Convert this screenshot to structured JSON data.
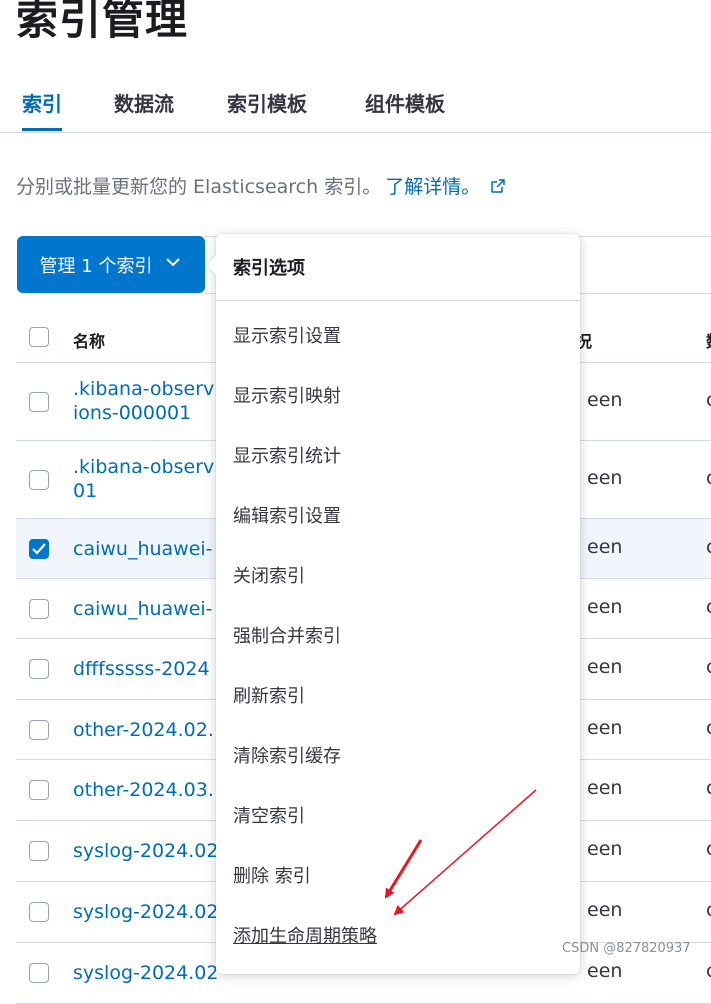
{
  "page": {
    "title": "索引管理"
  },
  "tabs": [
    "索引",
    "数据流",
    "索引模板",
    "组件模板"
  ],
  "description": {
    "text": "分别或批量更新您的 Elasticsearch 索引。",
    "link": "了解详情。"
  },
  "manage_button": {
    "label": "管理 1 个索引"
  },
  "table": {
    "headers": {
      "name": "名称",
      "health": "况",
      "more": "数"
    },
    "rows": [
      {
        "name": ".kibana-observ\nions-000001",
        "health": "een",
        "more": "c",
        "checked": false
      },
      {
        "name": ".kibana-observ\n01",
        "health": "een",
        "more": "c",
        "checked": false
      },
      {
        "name": "caiwu_huawei-",
        "health": "een",
        "more": "c",
        "checked": true
      },
      {
        "name": "caiwu_huawei-",
        "health": "een",
        "more": "c",
        "checked": false
      },
      {
        "name": "dfffsssss-2024",
        "health": "een",
        "more": "c",
        "checked": false
      },
      {
        "name": "other-2024.02.",
        "health": "een",
        "more": "c",
        "checked": false
      },
      {
        "name": "other-2024.03.",
        "health": "een",
        "more": "c",
        "checked": false
      },
      {
        "name": "syslog-2024.02",
        "health": "een",
        "more": "c",
        "checked": false
      },
      {
        "name": "syslog-2024.02",
        "health": "een",
        "more": "c",
        "checked": false
      },
      {
        "name": "syslog-2024.02",
        "health": "een",
        "more": "c",
        "checked": false
      }
    ]
  },
  "menu": {
    "title": "索引选项",
    "items": [
      "显示索引设置",
      "显示索引映射",
      "显示索引统计",
      "编辑索引设置",
      "关闭索引",
      "强制合并索引",
      "刷新索引",
      "清除索引缓存",
      "清空索引",
      "删除 索引",
      "添加生命周期策略"
    ]
  },
  "watermark": "CSDN @827820937",
  "colors": {
    "primary": "#0077cc",
    "link": "#006bb8",
    "annotation": "#e8161d"
  },
  "icons": {
    "chevron": "chevron-down-icon",
    "external": "external-link-icon",
    "check": "check-icon"
  }
}
